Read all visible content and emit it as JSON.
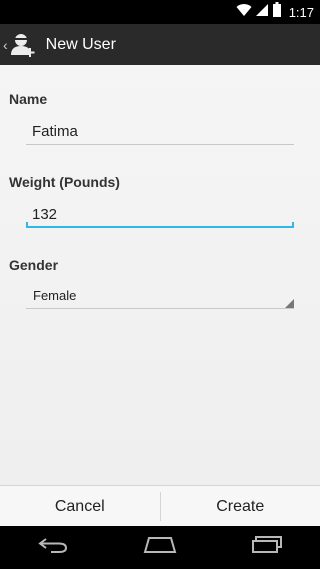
{
  "status_bar": {
    "time": "1:17",
    "icons": [
      "wifi-icon",
      "signal-icon",
      "battery-icon"
    ]
  },
  "action_bar": {
    "title": "New User",
    "icon": "add-user-icon"
  },
  "form": {
    "name_label": "Name",
    "name_value": "Fatima",
    "weight_label": "Weight (Pounds)",
    "weight_value": "132",
    "gender_label": "Gender",
    "gender_value": "Female"
  },
  "buttons": {
    "cancel": "Cancel",
    "create": "Create"
  },
  "navigation": {
    "icons": [
      "back-icon",
      "home-icon",
      "recent-apps-icon"
    ]
  },
  "colors": {
    "accent": "#33b5e5",
    "action_bar": "#2a2a2a"
  }
}
